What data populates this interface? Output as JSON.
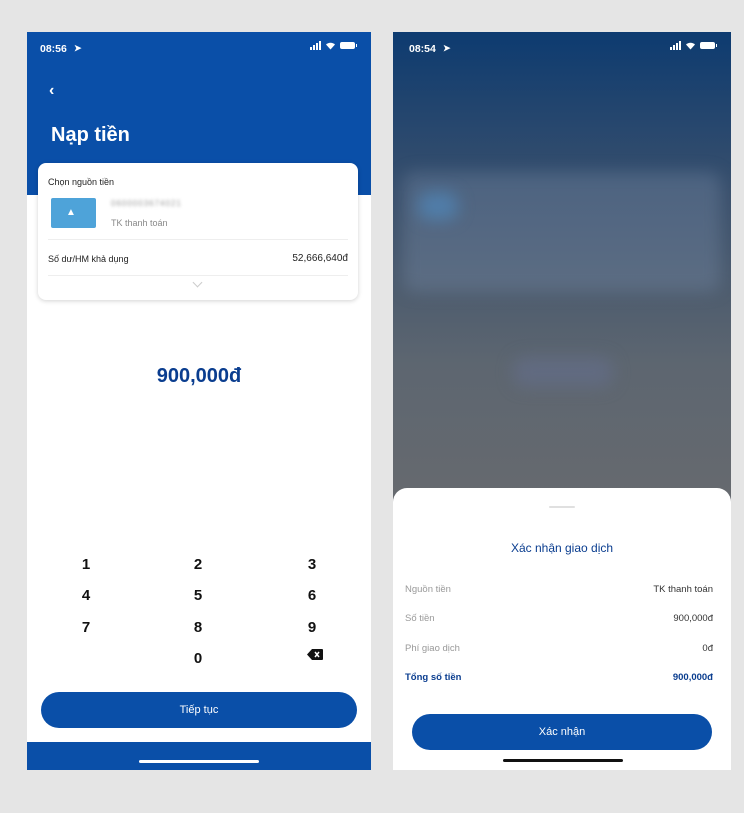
{
  "left_screen": {
    "status_time": "08:56",
    "title": "Nạp tiền",
    "source_card": {
      "label": "Chọn nguồn tiền",
      "account_number_masked": "0600003674021",
      "account_type": "TK thanh toán",
      "balance_label": "Số dư/HM khả dụng",
      "balance_value": "52,666,640đ"
    },
    "amount": "900,000đ",
    "keypad": {
      "k1": "1",
      "k2": "2",
      "k3": "3",
      "k4": "4",
      "k5": "5",
      "k6": "6",
      "k7": "7",
      "k8": "8",
      "k9": "9",
      "k0": "0"
    },
    "continue_label": "Tiếp tục"
  },
  "right_screen": {
    "status_time": "08:54",
    "sheet_title": "Xác nhận giao dịch",
    "rows": [
      {
        "label": "Nguồn tiền",
        "value": "TK thanh toán"
      },
      {
        "label": "Số tiền",
        "value": "900,000đ"
      },
      {
        "label": "Phí giao dịch",
        "value": "0đ"
      },
      {
        "label": "Tổng số tiền",
        "value": "900,000đ"
      }
    ],
    "confirm_label": "Xác nhận"
  },
  "colors": {
    "brand_blue": "#0a4fa8",
    "title_blue": "#0a3d8f",
    "background": "#e5e5e5"
  },
  "icons": [
    "back-chevron-icon",
    "location-arrow-icon",
    "signal-icon",
    "wifi-icon",
    "battery-icon",
    "card-thumbnail-icon",
    "chevron-down-icon",
    "backspace-icon"
  ]
}
